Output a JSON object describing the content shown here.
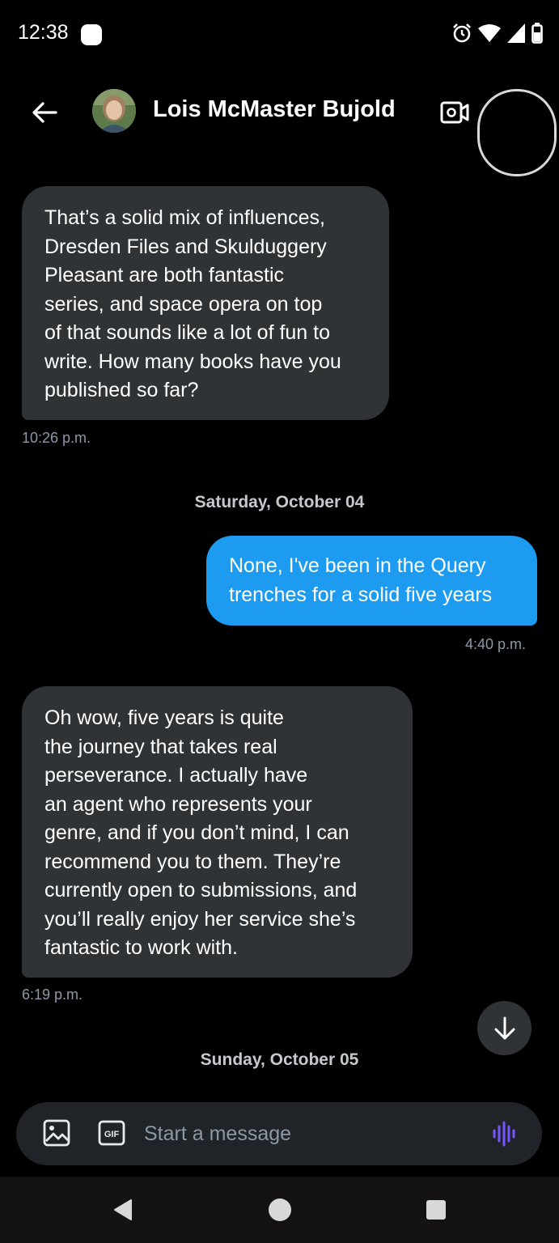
{
  "status_bar": {
    "time": "12:38",
    "icons": [
      "alarm-icon",
      "wifi-icon",
      "signal-icon",
      "battery-icon"
    ]
  },
  "header": {
    "contact_name": "Lois McMaster Bujold",
    "back_icon": "arrow-left-icon",
    "video_icon": "video-call-icon"
  },
  "messages": [
    {
      "direction": "in",
      "text": "That’s a solid mix of influences,\nDresden Files and Skulduggery\nPleasant are both fantastic\nseries, and space opera on top\nof that sounds like a lot of fun to\nwrite. How many books have you\npublished so far?",
      "time": "10:26 p.m."
    },
    {
      "direction": "out",
      "text": "None, I've been in the Query\ntrenches for a solid five years",
      "time": "4:40 p.m."
    },
    {
      "direction": "in",
      "text": "Oh wow, five years is quite\nthe journey that takes real\nperseverance. I actually have\nan agent who represents your\ngenre, and if you don’t mind, I can\nrecommend you to them. They’re\ncurrently open to submissions, and\nyou’ll really enjoy her service she’s\nfantastic to work with.",
      "time": "6:19 p.m."
    }
  ],
  "date_separators": [
    "Saturday, October 04",
    "Sunday, October 05"
  ],
  "composer": {
    "placeholder": "Start a message",
    "gif_label": "GIF"
  },
  "colors": {
    "background": "#000000",
    "incoming_bubble": "#2f3336",
    "outgoing_bubble": "#1d9bf0",
    "voice_accent": "#7856ff"
  }
}
